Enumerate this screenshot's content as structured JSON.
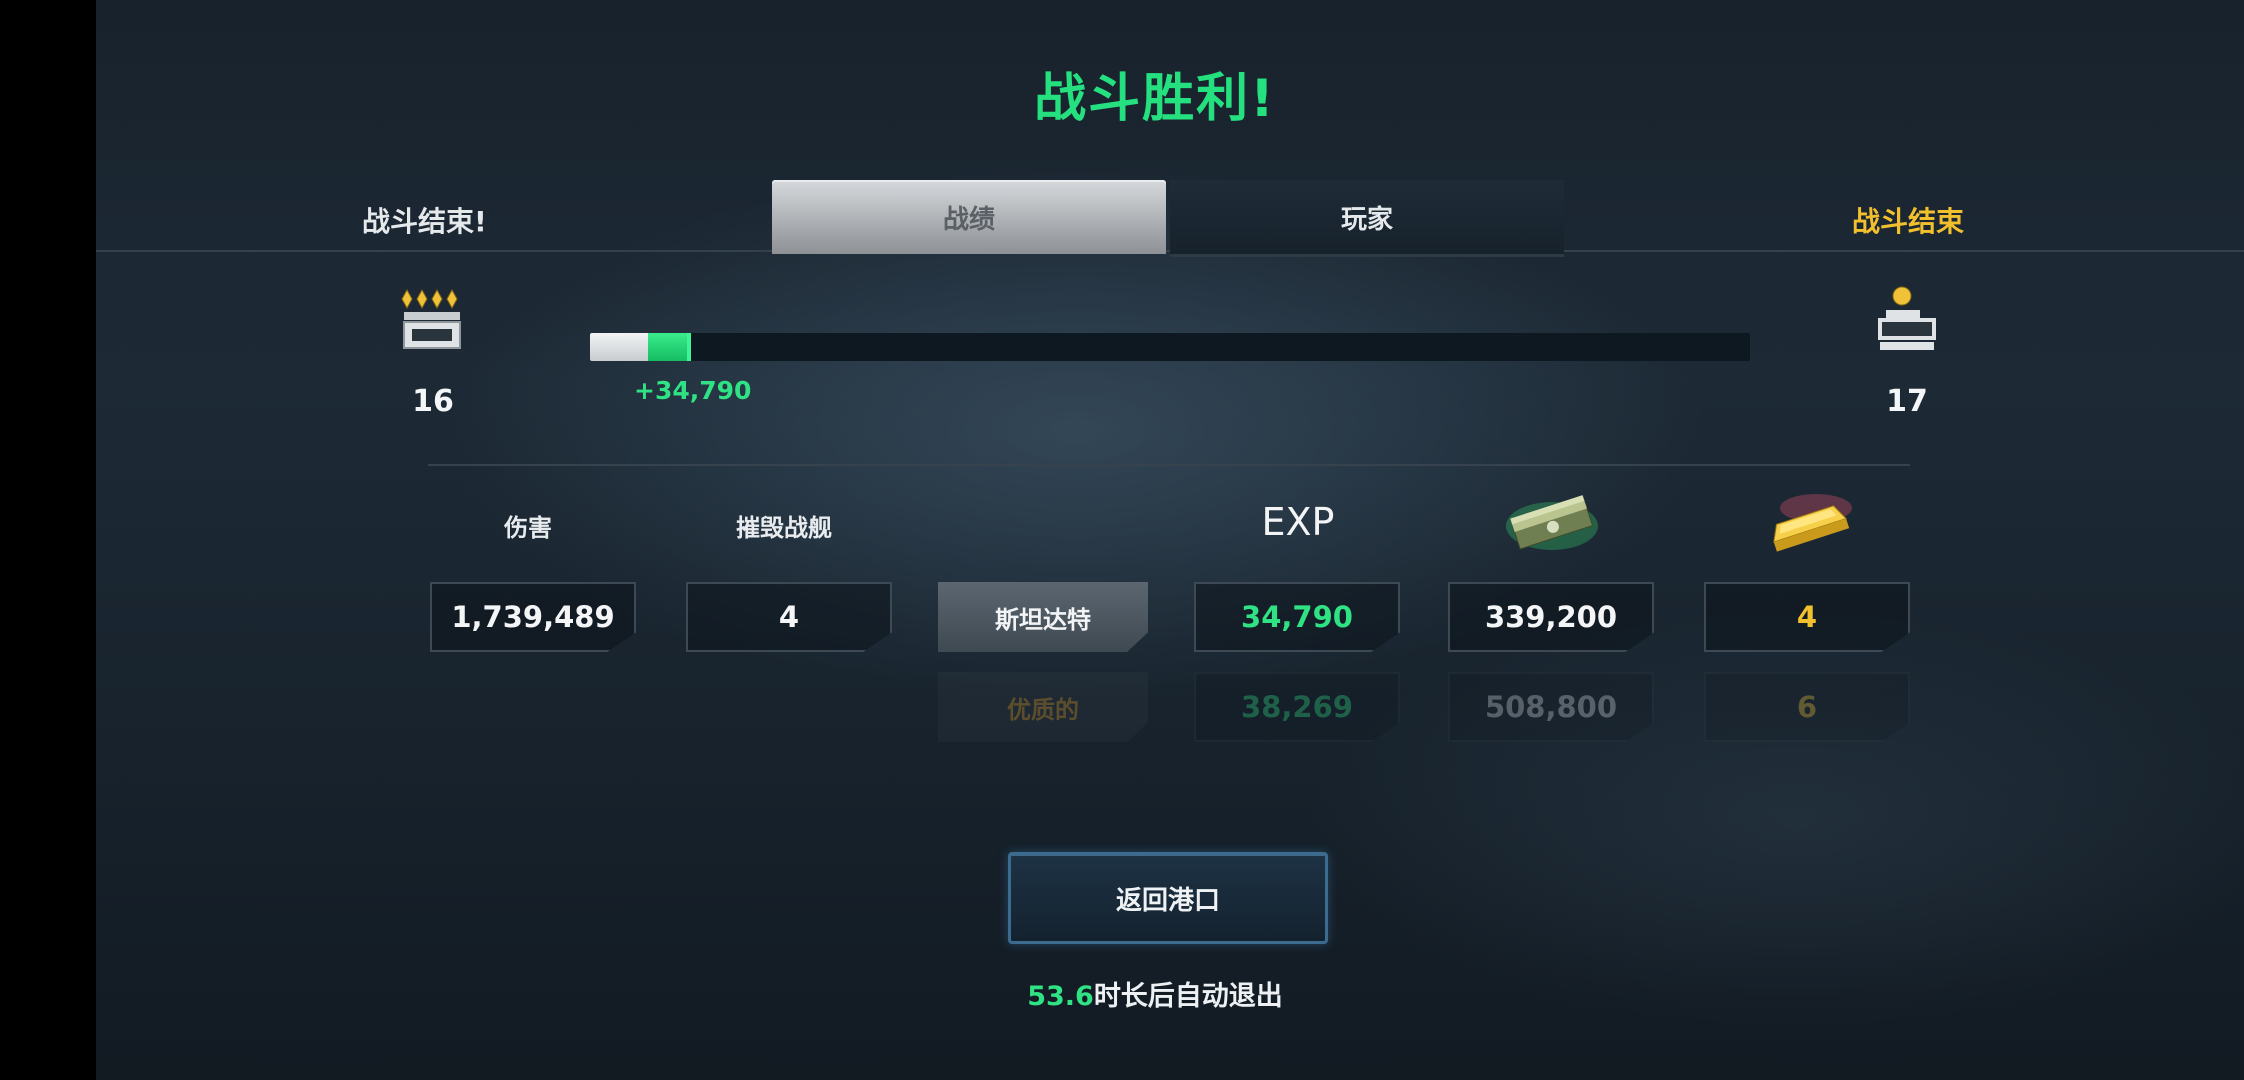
{
  "title": "战斗胜利!",
  "header": {
    "left_status": "战斗结束!",
    "right_status": "战斗结束",
    "tabs": [
      {
        "label": "战绩",
        "active": true
      },
      {
        "label": "玩家",
        "active": false
      }
    ]
  },
  "rank": {
    "current": "16",
    "next": "17",
    "xp_gain_label": "+34,790",
    "progress_before": 0.05,
    "progress_after": 0.085
  },
  "stats": {
    "damage_label": "伤害",
    "kills_label": "摧毁战舰",
    "exp_label": "EXP",
    "money_icon": "cash-stack-icon",
    "gold_icon": "gold-bar-icon",
    "damage_value": "1,739,489",
    "kills_value": "4",
    "standard": {
      "label": "斯坦达特",
      "exp": "34,790",
      "money": "339,200",
      "gold": "4"
    },
    "premium": {
      "label": "优质的",
      "exp": "38,269",
      "money": "508,800",
      "gold": "6"
    }
  },
  "colors": {
    "accent_green": "#2fe384",
    "accent_gold": "#f3c02d"
  },
  "footer": {
    "return_label": "返回港口",
    "timer": "53.6",
    "auto_exit_text": "时长后自动退出"
  }
}
